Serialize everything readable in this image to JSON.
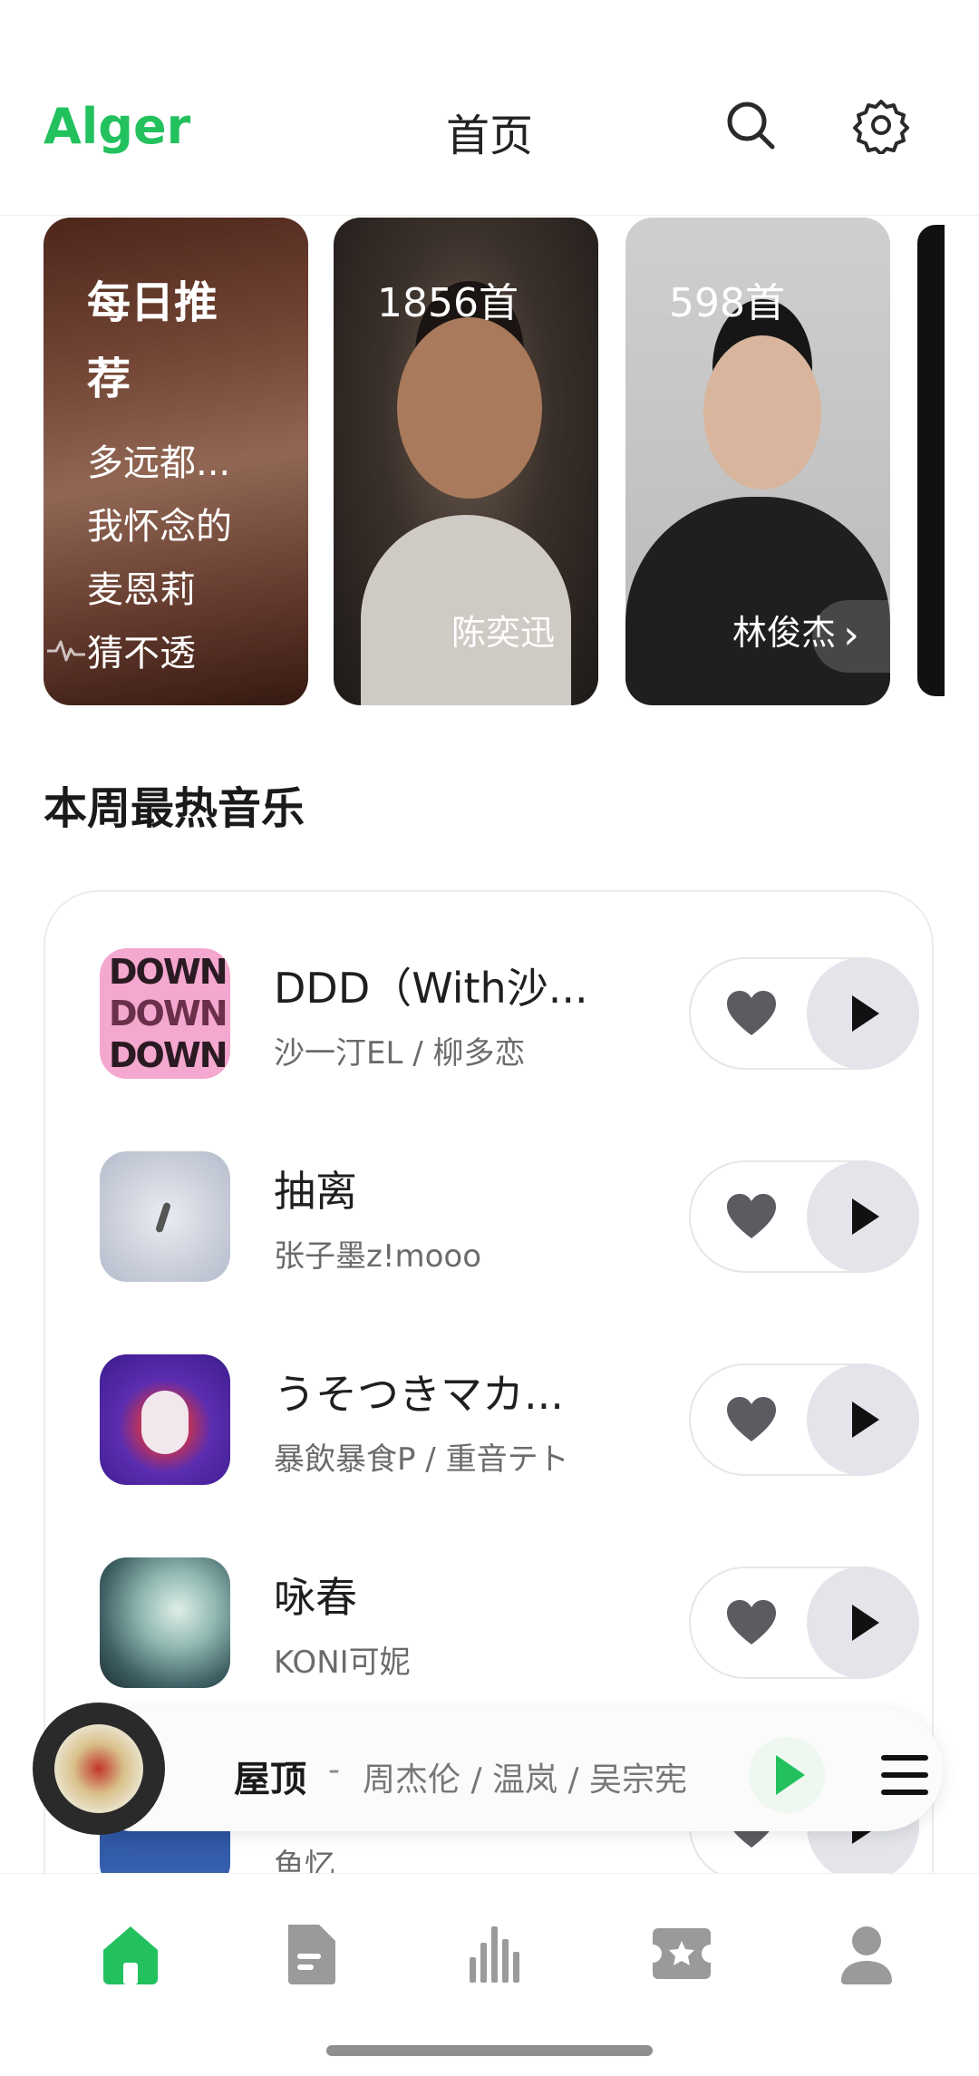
{
  "header": {
    "app_name": "Alger",
    "title": "首页"
  },
  "carousel": {
    "daily": {
      "title": "每日推荐",
      "songs": [
        "多远都...",
        "我怀念的",
        "麦恩莉",
        "猜不透"
      ]
    },
    "artists": [
      {
        "count": "1856首",
        "name": "陈奕迅"
      },
      {
        "count": "598首",
        "name": "林俊杰"
      }
    ],
    "more_arrow": "›"
  },
  "section": {
    "title": "本周最热音乐"
  },
  "songs": [
    {
      "name": "DDD（With沙...",
      "artist": "沙一汀EL / 柳多恋"
    },
    {
      "name": "抽离",
      "artist": "张子墨z!mooo"
    },
    {
      "name": "うそつきマカ...",
      "artist": "暴飲暴食P / 重音テト"
    },
    {
      "name": "咏春",
      "artist": "KONI可妮"
    },
    {
      "name": "",
      "artist": "鱼忆"
    }
  ],
  "cover_text": {
    "song1": [
      "DOWN",
      "DOWN",
      "DOWN"
    ]
  },
  "player": {
    "song": "屋顶",
    "separator": "-",
    "artist": "周杰伦 / 温岚 / 吴宗宪"
  },
  "colors": {
    "accent": "#22c15e",
    "icon_gray": "#9a9a9a",
    "text_primary": "#1f1f1f",
    "text_secondary": "#6b6b6b"
  },
  "icons": {
    "header": [
      "search-icon",
      "gear-icon"
    ],
    "nav": [
      "home-icon",
      "document-icon",
      "chart-icon",
      "video-icon",
      "user-icon"
    ],
    "row": [
      "heart-icon",
      "play-icon"
    ],
    "player": [
      "play-icon",
      "menu-icon"
    ]
  }
}
